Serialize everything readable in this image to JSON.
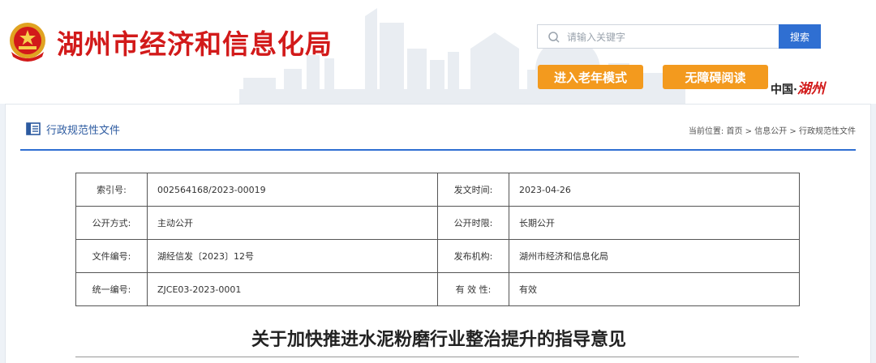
{
  "header": {
    "site_title": "湖州市经济和信息化局",
    "search": {
      "placeholder": "请输入关键字",
      "button_label": "搜索"
    },
    "elder_mode_label": "进入老年模式",
    "accessibility_label": "无障碍阅读",
    "brand_prefix": "中国·",
    "brand_city": "湖州",
    "colors": {
      "title_red": "#d21a1a",
      "orange": "#f39a1e",
      "blue": "#2f6fd2"
    }
  },
  "section": {
    "title": "行政规范性文件",
    "breadcrumb_prefix": "当前位置:",
    "breadcrumb": [
      "首页",
      "信息公开",
      "行政规范性文件"
    ],
    "breadcrumb_sep": ">"
  },
  "meta": {
    "rows": [
      {
        "k1": "索引号:",
        "v1": "002564168/2023-00019",
        "k2": "发文时间:",
        "v2": "2023-04-26"
      },
      {
        "k1": "公开方式:",
        "v1": "主动公开",
        "k2": "公开时限:",
        "v2": "长期公开"
      },
      {
        "k1": "文件编号:",
        "v1": "湖经信发〔2023〕12号",
        "k2": "发布机构:",
        "v2": "湖州市经济和信息化局"
      },
      {
        "k1": "统一编号:",
        "v1": "ZJCE03-2023-0001",
        "k2": "有 效 性:",
        "v2": "有效"
      }
    ]
  },
  "document": {
    "title": "关于加快推进水泥粉磨行业整治提升的指导意见"
  }
}
